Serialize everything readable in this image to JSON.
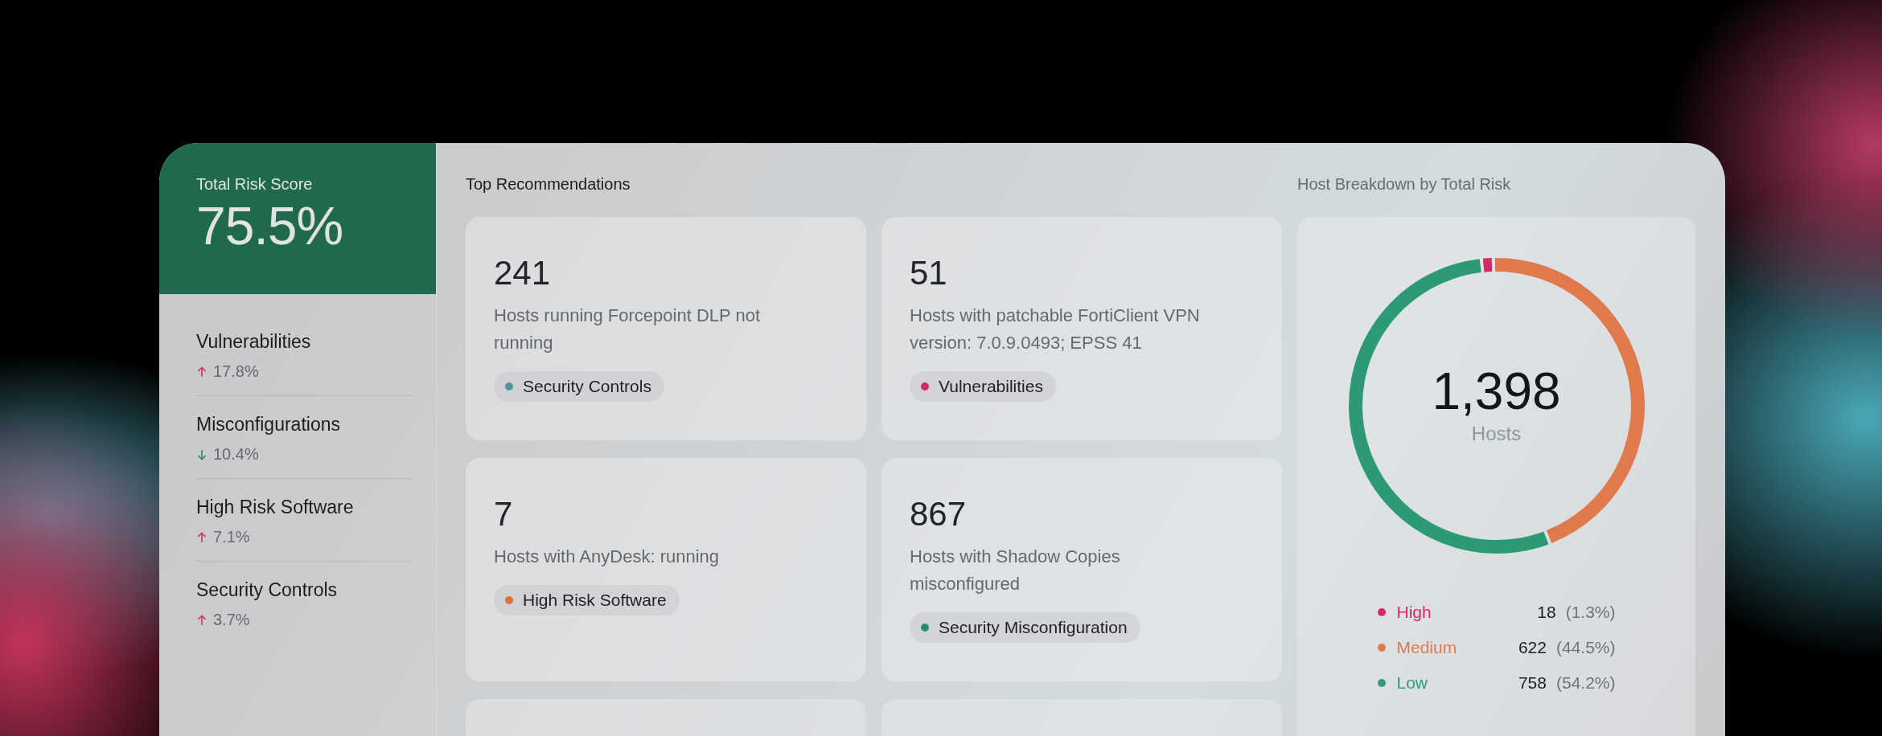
{
  "summary": {
    "label": "Total Risk Score",
    "value": "75.5%"
  },
  "sidebar": {
    "items": [
      {
        "label": "Vulnerabilities",
        "change": "17.8%",
        "kind": "up"
      },
      {
        "label": "Misconfigurations",
        "change": "10.4%",
        "kind": "down"
      },
      {
        "label": "High Risk Software",
        "change": "7.1%",
        "kind": "up"
      },
      {
        "label": "Security Controls",
        "change": "3.7%",
        "kind": "up"
      }
    ]
  },
  "recommendations": {
    "title": "Top Recommendations",
    "cards": [
      {
        "count": "241",
        "description": "Hosts running Forcepoint DLP not running",
        "tag": "Security Controls",
        "color": "#4f95a6"
      },
      {
        "count": "51",
        "description": "Hosts with patchable FortiClient VPN version: 7.0.9.0493; EPSS 41",
        "tag": "Vulnerabilities",
        "color": "#d42a63"
      },
      {
        "count": "7",
        "description": "Hosts with AnyDesk: running",
        "tag": "High Risk Software",
        "color": "#e0703a"
      },
      {
        "count": "867",
        "description": "Hosts with Shadow Copies misconfigured",
        "tag": "Security Misconfiguration",
        "color": "#2a8f68"
      }
    ]
  },
  "breakdown": {
    "title": "Host Breakdown by Total Risk",
    "total": "1,398",
    "total_label": "Hosts",
    "chart_data": {
      "type": "donut",
      "categories": [
        "High",
        "Medium",
        "Low"
      ],
      "values": [
        1.3,
        44.5,
        54.2
      ]
    },
    "legend": [
      {
        "count": "18",
        "percent": "(1.3%)",
        "color": "#d42a63"
      },
      {
        "count": "622",
        "percent": "(44.5%)",
        "color": "#e07a4c"
      },
      {
        "count": "758",
        "percent": "(54.2%)",
        "color": "#2e9a74"
      }
    ]
  }
}
